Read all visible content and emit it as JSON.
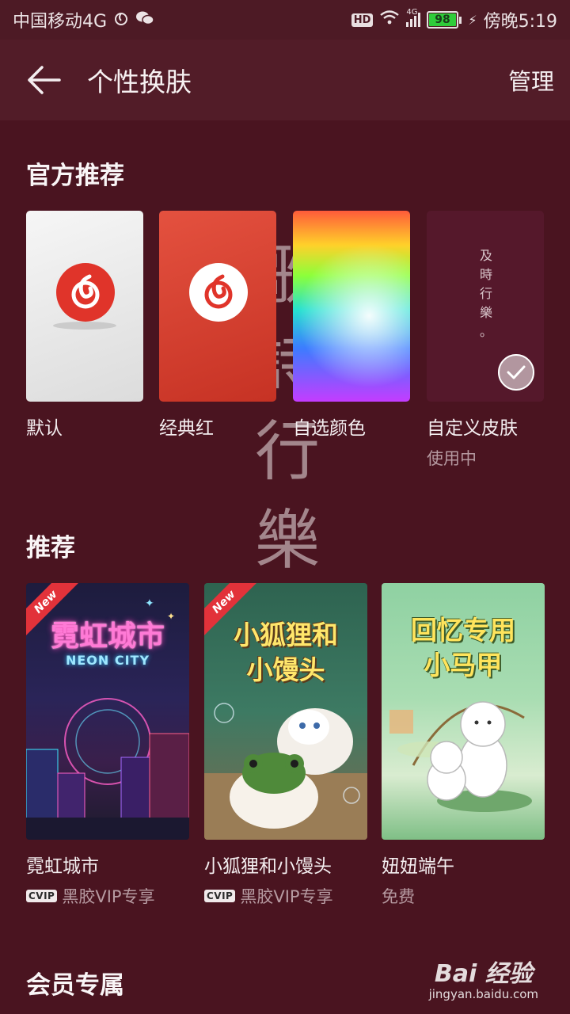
{
  "status_bar": {
    "carrier": "中国移动4G",
    "hd": "HD",
    "signal_label": "4G",
    "battery": "98",
    "battery_level": 0.98,
    "time": "傍晚5:19"
  },
  "appbar": {
    "title": "个性换肤",
    "manage_label": "管理"
  },
  "background_decor": {
    "chars": [
      "歌",
      "詩",
      "行",
      "樂"
    ]
  },
  "official": {
    "title": "官方推荐",
    "skins": [
      {
        "label": "默认",
        "subtitle": ""
      },
      {
        "label": "经典红",
        "subtitle": ""
      },
      {
        "label": "自选颜色",
        "subtitle": ""
      },
      {
        "label": "自定义皮肤",
        "subtitle": "使用中",
        "poem": "及時行樂。",
        "selected": true
      }
    ]
  },
  "recommended": {
    "title": "推荐",
    "items": [
      {
        "name": "霓虹城市",
        "badge": "CVIP",
        "price": "黑胶VIP专享",
        "is_new": true,
        "ribbon": "New",
        "art_title": "霓虹城市",
        "art_subtitle": "NEON CITY"
      },
      {
        "name": "小狐狸和小馒头",
        "badge": "CVIP",
        "price": "黑胶VIP专享",
        "is_new": true,
        "ribbon": "New",
        "art_title_line1": "小狐狸和",
        "art_title_line2": "小馒头"
      },
      {
        "name": "妞妞端午",
        "badge": "",
        "price": "免费",
        "is_new": false,
        "art_title_line1": "回忆专用",
        "art_title_line2": "小马甲"
      }
    ]
  },
  "member": {
    "title": "会员专属"
  },
  "watermark": {
    "logo": "Bai 经验",
    "url": "jingyan.baidu.com"
  },
  "colors": {
    "background": "#4a1420",
    "appbar": "#521c28",
    "brand_red": "#e0342a"
  }
}
